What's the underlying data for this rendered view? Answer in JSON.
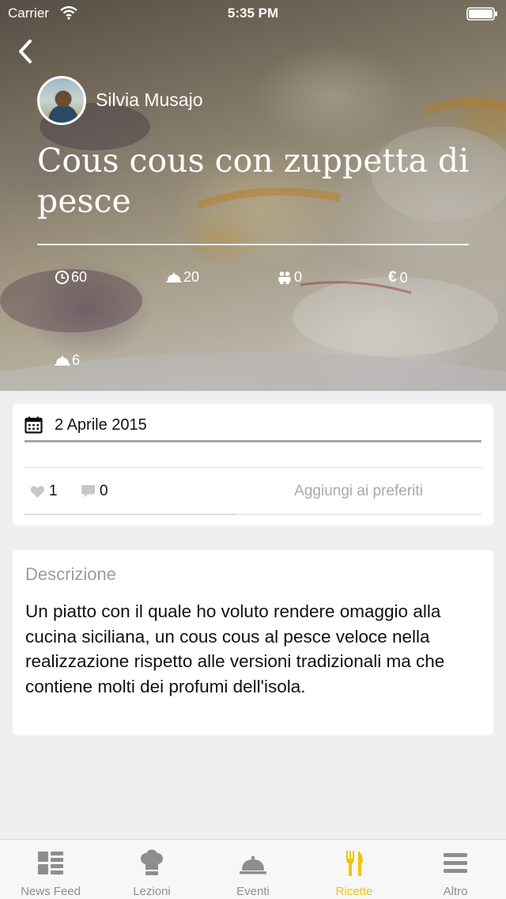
{
  "status_bar": {
    "carrier": "Carrier",
    "time": "5:35 PM"
  },
  "hero": {
    "author_name": "Silvia Musajo",
    "title": "Cous cous con zuppetta di pesce",
    "stats": {
      "time": "60",
      "difficulty": "20",
      "people": "0",
      "cost": "0",
      "servings": "6"
    },
    "icons": {
      "back": "chevron-left-icon",
      "time": "clock-icon",
      "difficulty": "cloche-icon",
      "people": "people-icon",
      "cost": "euro-icon",
      "servings": "cloche-icon"
    }
  },
  "details": {
    "date": "2 Aprile 2015",
    "likes": "1",
    "comments": "0",
    "favorite_label": "Aggiungi ai preferiti"
  },
  "description": {
    "heading": "Descrizione",
    "body": "Un piatto con il quale ho voluto rendere omaggio alla cucina siciliana, un cous cous al pesce veloce nella realizzazione rispetto alle versioni tradizionali ma che contiene molti dei profumi dell'isola."
  },
  "tab_bar": {
    "tabs": [
      {
        "label": "News Feed",
        "icon": "news-feed-icon",
        "active": false
      },
      {
        "label": "Lezioni",
        "icon": "chef-hat-icon",
        "active": false
      },
      {
        "label": "Eventi",
        "icon": "cloche-icon",
        "active": false
      },
      {
        "label": "Ricette",
        "icon": "fork-knife-icon",
        "active": true
      },
      {
        "label": "Altro",
        "icon": "menu-icon",
        "active": false
      }
    ]
  },
  "colors": {
    "accent": "#f2c500",
    "inactive_tab": "#8e8e8e",
    "background": "#efeff1"
  }
}
